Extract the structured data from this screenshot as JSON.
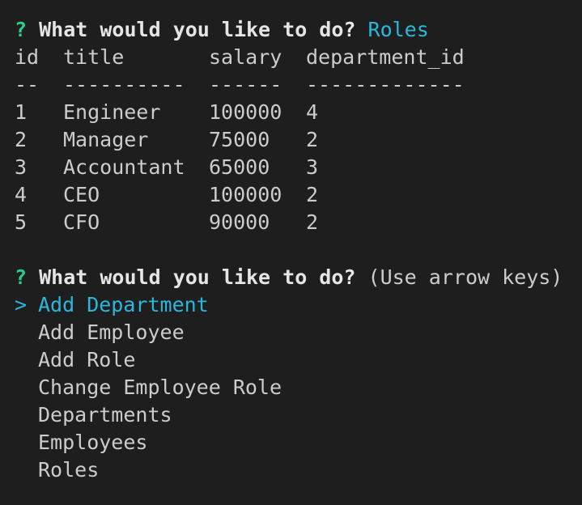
{
  "prompt1": {
    "marker": "?",
    "question": "What would you like to do?",
    "answer": "Roles"
  },
  "table": {
    "headers": [
      "id",
      "title",
      "salary",
      "department_id"
    ],
    "separators": [
      "--",
      "----------",
      "------",
      "-------------"
    ],
    "rows": [
      [
        "1",
        "Engineer",
        "100000",
        "4"
      ],
      [
        "2",
        "Manager",
        "75000",
        "2"
      ],
      [
        "3",
        "Accountant",
        "65000",
        "3"
      ],
      [
        "4",
        "CEO",
        "100000",
        "2"
      ],
      [
        "5",
        "CFO",
        "90000",
        "2"
      ]
    ]
  },
  "prompt2": {
    "marker": "?",
    "question": "What would you like to do?",
    "hint": "(Use arrow keys)"
  },
  "menu": {
    "pointer": ">",
    "items": [
      "Add Department",
      "Add Employee",
      "Add Role",
      "Change Employee Role",
      "Departments",
      "Employees",
      "Roles"
    ],
    "selected_index": 0
  },
  "colors": {
    "background": "#1e1e1e",
    "text": "#cccccc",
    "prompt_marker": "#23d18b",
    "accent": "#29b8db"
  }
}
